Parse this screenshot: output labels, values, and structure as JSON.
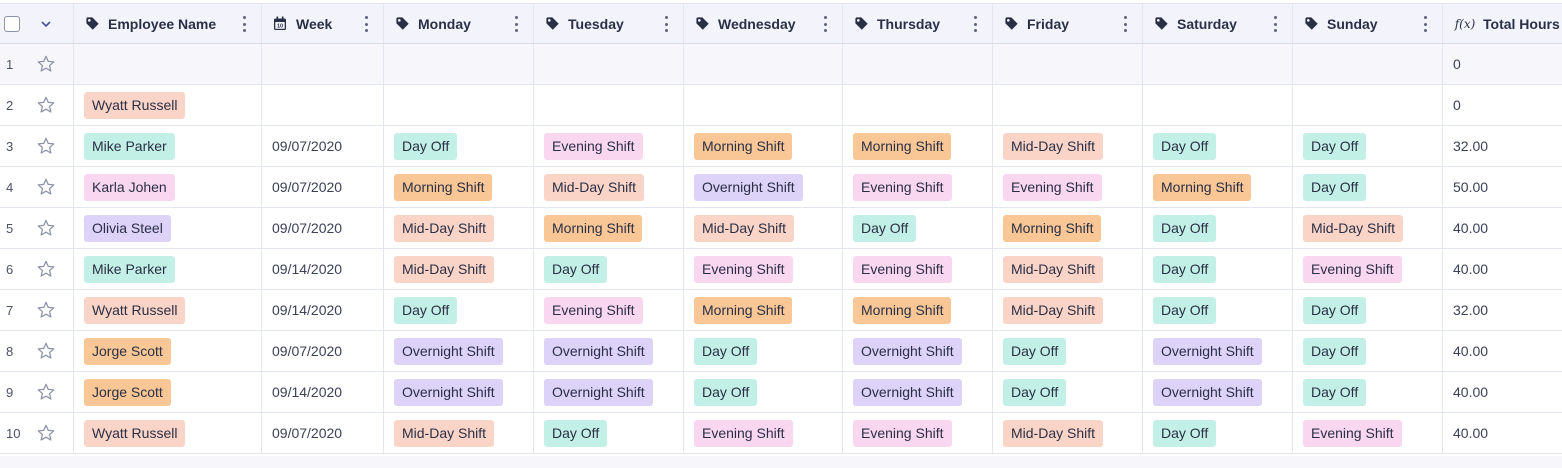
{
  "colors": {
    "Day Off": "#c3f0e6",
    "Evening Shift": "#fad7f0",
    "Morning Shift": "#f9c795",
    "Mid-Day Shift": "#fbd4c8",
    "Overnight Shift": "#ddd2f8",
    "Wyatt Russell": "#fbd4c8",
    "Mike Parker": "#c3f0e6",
    "Karla Johen": "#fad7f0",
    "Olivia Steel": "#ddd2f8",
    "Jorge Scott": "#f9c795"
  },
  "headers": [
    {
      "label": "Employee Name",
      "icon": "tag-icon"
    },
    {
      "label": "Week",
      "icon": "calendar-icon"
    },
    {
      "label": "Monday",
      "icon": "tag-icon"
    },
    {
      "label": "Tuesday",
      "icon": "tag-icon"
    },
    {
      "label": "Wednesday",
      "icon": "tag-icon"
    },
    {
      "label": "Thursday",
      "icon": "tag-icon"
    },
    {
      "label": "Friday",
      "icon": "tag-icon"
    },
    {
      "label": "Saturday",
      "icon": "tag-icon"
    },
    {
      "label": "Sunday",
      "icon": "tag-icon"
    },
    {
      "label": "Total Hours",
      "icon": "formula-icon",
      "icon_text": "f(x)"
    }
  ],
  "rows": [
    {
      "num": "1",
      "name": "",
      "week": "",
      "days": [
        "",
        "",
        "",
        "",
        "",
        "",
        ""
      ],
      "total": "0"
    },
    {
      "num": "2",
      "name": "Wyatt Russell",
      "week": "",
      "days": [
        "",
        "",
        "",
        "",
        "",
        "",
        ""
      ],
      "total": "0"
    },
    {
      "num": "3",
      "name": "Mike Parker",
      "week": "09/07/2020",
      "days": [
        "Day Off",
        "Evening Shift",
        "Morning Shift",
        "Morning Shift",
        "Mid-Day Shift",
        "Day Off",
        "Day Off"
      ],
      "total": "32.00"
    },
    {
      "num": "4",
      "name": "Karla Johen",
      "week": "09/07/2020",
      "days": [
        "Morning Shift",
        "Mid-Day Shift",
        "Overnight Shift",
        "Evening Shift",
        "Evening Shift",
        "Morning Shift",
        "Day Off"
      ],
      "total": "50.00"
    },
    {
      "num": "5",
      "name": "Olivia Steel",
      "week": "09/07/2020",
      "days": [
        "Mid-Day Shift",
        "Morning Shift",
        "Mid-Day Shift",
        "Day Off",
        "Morning Shift",
        "Day Off",
        "Mid-Day Shift"
      ],
      "total": "40.00"
    },
    {
      "num": "6",
      "name": "Mike Parker",
      "week": "09/14/2020",
      "days": [
        "Mid-Day Shift",
        "Day Off",
        "Evening Shift",
        "Evening Shift",
        "Mid-Day Shift",
        "Day Off",
        "Evening Shift"
      ],
      "total": "40.00"
    },
    {
      "num": "7",
      "name": "Wyatt Russell",
      "week": "09/14/2020",
      "days": [
        "Day Off",
        "Evening Shift",
        "Morning Shift",
        "Morning Shift",
        "Mid-Day Shift",
        "Day Off",
        "Day Off"
      ],
      "total": "32.00"
    },
    {
      "num": "8",
      "name": "Jorge Scott",
      "week": "09/07/2020",
      "days": [
        "Overnight Shift",
        "Overnight Shift",
        "Day Off",
        "Overnight Shift",
        "Day Off",
        "Overnight Shift",
        "Day Off"
      ],
      "total": "40.00"
    },
    {
      "num": "9",
      "name": "Jorge Scott",
      "week": "09/14/2020",
      "days": [
        "Overnight Shift",
        "Overnight Shift",
        "Day Off",
        "Overnight Shift",
        "Day Off",
        "Overnight Shift",
        "Day Off"
      ],
      "total": "40.00"
    },
    {
      "num": "10",
      "name": "Wyatt Russell",
      "week": "09/07/2020",
      "days": [
        "Mid-Day Shift",
        "Day Off",
        "Evening Shift",
        "Evening Shift",
        "Mid-Day Shift",
        "Day Off",
        "Evening Shift"
      ],
      "total": "40.00"
    }
  ]
}
